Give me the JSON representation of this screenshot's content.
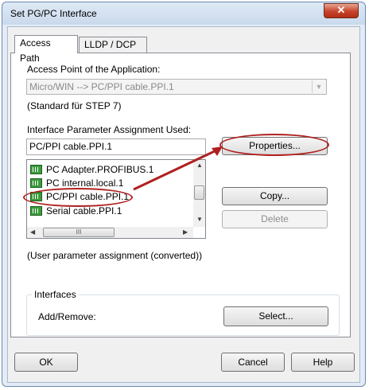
{
  "window": {
    "title": "Set PG/PC Interface",
    "close_glyph": "✕"
  },
  "tabs": [
    {
      "label": "Access Path"
    },
    {
      "label": "LLDP / DCP"
    }
  ],
  "access_point": {
    "label": "Access Point of the Application:",
    "value": "Micro/WIN      --> PC/PPI cable.PPI.1",
    "note": "(Standard für STEP 7)"
  },
  "interface_param": {
    "label": "Interface Parameter Assignment Used:",
    "value": "PC/PPI cable.PPI.1",
    "items": [
      "PC Adapter.PROFIBUS.1",
      "PC internal.local.1",
      "PC/PPI cable.PPI.1",
      "Serial cable.PPI.1"
    ],
    "scroll_h_thumb": "III"
  },
  "buttons": {
    "properties": "Properties...",
    "copy": "Copy...",
    "delete": "Delete",
    "select": "Select...",
    "ok": "OK",
    "cancel": "Cancel",
    "help": "Help"
  },
  "user_param_note": "(User parameter assignment (converted))",
  "interfaces": {
    "title": "Interfaces",
    "add_remove_label": "Add/Remove:"
  },
  "annotation": {
    "color": "#b02020"
  },
  "icons": [
    "close-icon",
    "dropdown-arrow-icon",
    "network-adapter-icon",
    "scroll-arrow-icon"
  ]
}
